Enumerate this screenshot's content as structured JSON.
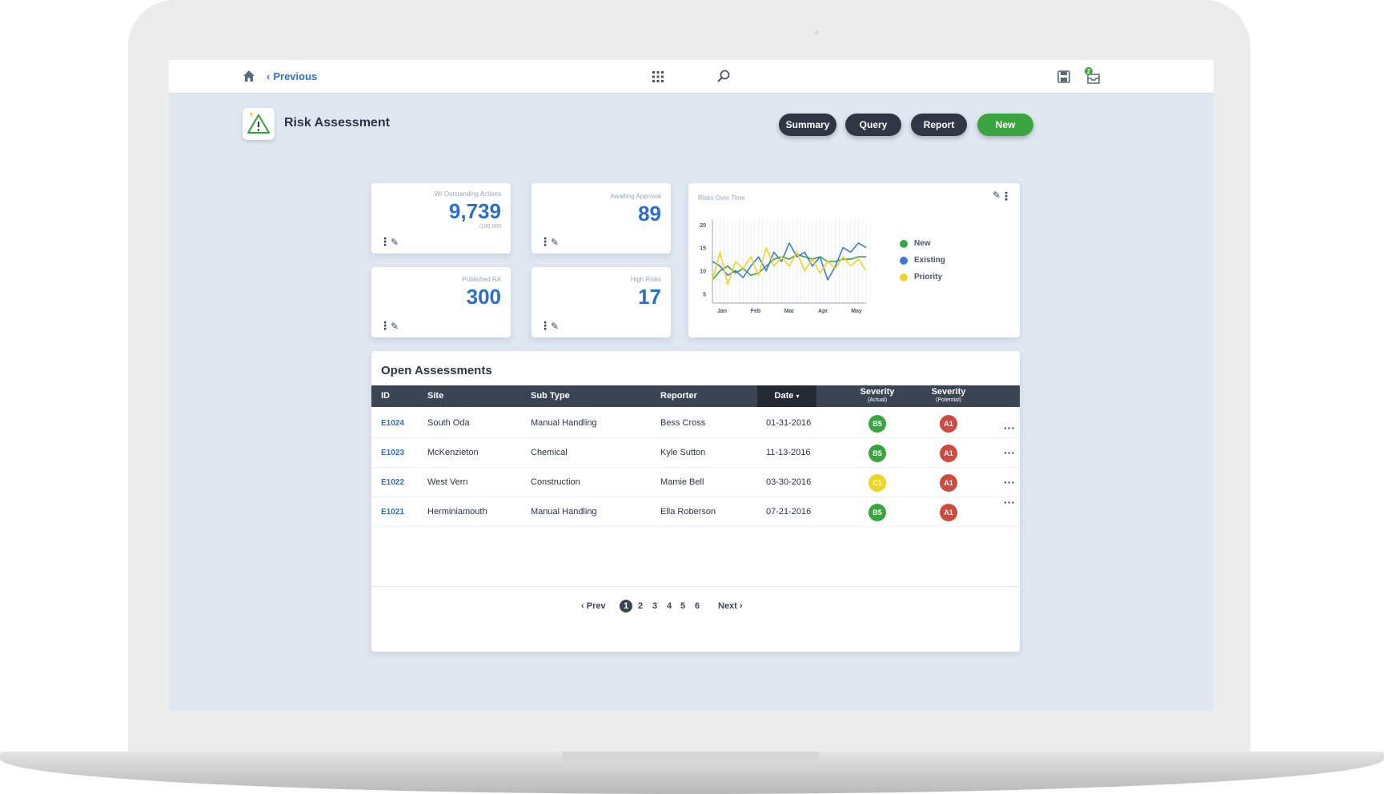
{
  "topbar": {
    "previous_label": "Previous",
    "inbox_count": "2",
    "icons": [
      "home-icon",
      "grid-icon",
      "search-icon",
      "save-icon",
      "inbox-icon"
    ]
  },
  "header": {
    "title": "Risk Assessment",
    "buttons": {
      "summary": "Summary",
      "query": "Query",
      "report": "Report",
      "new": "New"
    }
  },
  "stats": [
    {
      "label": "W/ Outstanding Actions",
      "value": "9,739",
      "sub": "/100,000"
    },
    {
      "label": "Awaiting Approval",
      "value": "89"
    },
    {
      "label": "Published RA",
      "value": "300"
    },
    {
      "label": "High Risks",
      "value": "17"
    }
  ],
  "colors": {
    "accent_blue": "#2a6fd0",
    "green": "#3aa43f",
    "yellow": "#ecd622",
    "red": "#cf4a3e",
    "dark": "#2f3744"
  },
  "chart_data": {
    "type": "line",
    "title": "Risks Over Time",
    "x_tick_labels": [
      "Jan",
      "Feb",
      "Mar",
      "Apr",
      "May"
    ],
    "yticks": [
      20,
      15,
      10,
      5
    ],
    "ylim": [
      3,
      21
    ],
    "grid": true,
    "legend_position": "right",
    "series": [
      {
        "name": "New",
        "color": "#3aa43f",
        "values": [
          8,
          10,
          11,
          9.5,
          10.5,
          9,
          9.5,
          11,
          12.5,
          13,
          12.5,
          13.5,
          13,
          12.5,
          13,
          12,
          12,
          12.5,
          12.5,
          13,
          13
        ]
      },
      {
        "name": "Existing",
        "color": "#3a7bd5",
        "values": [
          12,
          11,
          9,
          10,
          8.5,
          11,
          13,
          10,
          14,
          12,
          16,
          13,
          14,
          11,
          13,
          8,
          11,
          15,
          14,
          16,
          15
        ]
      },
      {
        "name": "Priority",
        "color": "#ecd622",
        "values": [
          8,
          14,
          7,
          12,
          10.5,
          13,
          9,
          15,
          11,
          13,
          11,
          14,
          10,
          12.5,
          9.5,
          12,
          10.5,
          13,
          11,
          12.5,
          10
        ]
      }
    ]
  },
  "table": {
    "title": "Open Assessments",
    "headers": {
      "id": "ID",
      "site": "Site",
      "subtype": "Sub Type",
      "reporter": "Reporter",
      "date": "Date",
      "sev_actual": "Severity",
      "sev_actual_sub": "(Actual)",
      "sev_potential": "Severity",
      "sev_potential_sub": "(Potential)"
    },
    "rows": [
      {
        "id": "E1024",
        "site": "South Oda",
        "subtype": "Manual Handling",
        "reporter": "Bess Cross",
        "date": "01-31-2016",
        "actual": "B5",
        "actual_color": "#3aa43f",
        "potential": "A1",
        "potential_color": "#cf4a3e"
      },
      {
        "id": "E1023",
        "site": "McKenzieton",
        "subtype": "Chemical",
        "reporter": "Kyle Sutton",
        "date": "11-13-2016",
        "actual": "B5",
        "actual_color": "#3aa43f",
        "potential": "A1",
        "potential_color": "#cf4a3e"
      },
      {
        "id": "E1022",
        "site": "West Vern",
        "subtype": "Construction",
        "reporter": "Mamie Bell",
        "date": "03-30-2016",
        "actual": "C1",
        "actual_color": "#ecd622",
        "potential": "A1",
        "potential_color": "#cf4a3e"
      },
      {
        "id": "E1021",
        "site": "Herminiamouth",
        "subtype": "Manual Handling",
        "reporter": "Ella Roberson",
        "date": "07-21-2016",
        "actual": "B5",
        "actual_color": "#3aa43f",
        "potential": "A1",
        "potential_color": "#cf4a3e"
      }
    ]
  },
  "pagination": {
    "prev": "Prev",
    "next": "Next",
    "pages": [
      "1",
      "2",
      "3",
      "4",
      "5",
      "6"
    ],
    "current": "1"
  }
}
